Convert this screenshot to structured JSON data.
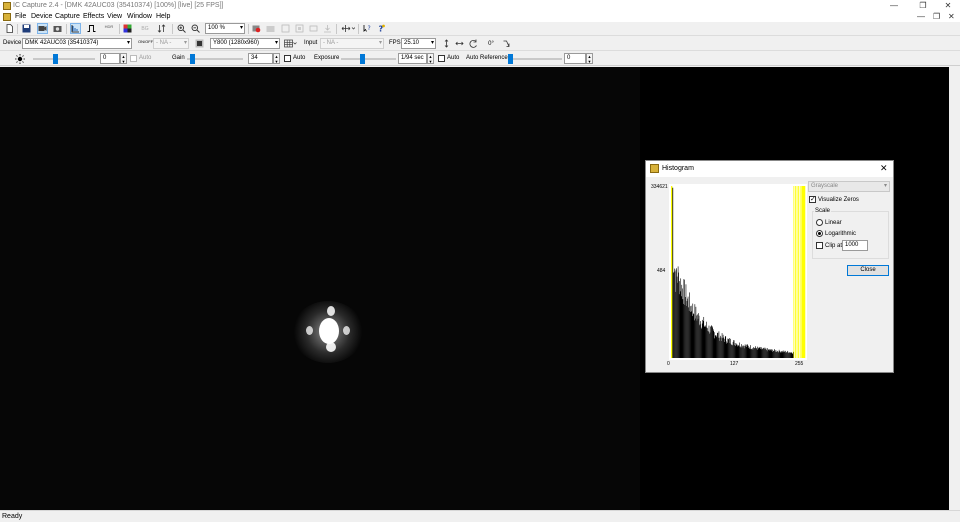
{
  "window": {
    "title": "IC Capture 2.4 - [DMK 42AUC03 (35410374) [100%]  [live]  [25 FPS]]",
    "controls": [
      "—",
      "❐",
      "✕"
    ]
  },
  "menu": [
    "File",
    "Device",
    "Capture",
    "Effects",
    "View",
    "Window",
    "Help"
  ],
  "mdi_controls": [
    "—",
    "❐",
    "✕"
  ],
  "toolbar": {
    "zoom_value": "100 %",
    "btn_hdr": "HDR",
    "btn_bg": "BG",
    "btn_onoff": "ON/OFF",
    "btn_angle": "0°"
  },
  "device_bar": {
    "device_label": "Device",
    "device_value": "DMK 42AUC03 (35410374)",
    "na_combo_1": "- NA -",
    "format_value": "Y800 (1280x960)",
    "input_label": "Input",
    "input_value": "- NA -",
    "fps_label": "FPS",
    "fps_value": "25.10"
  },
  "properties_bar": {
    "brightness_value": "0",
    "brightness_level": 0.35,
    "brightness_auto_label": "Auto",
    "gain_label": "Gain",
    "gain_value": "34",
    "gain_level": 0.06,
    "gain_auto_label": "Auto",
    "exposure_label": "Exposure",
    "exposure_value": "1/94 sec",
    "exposure_level": 0.38,
    "exposure_auto_label": "Auto",
    "auto_reference_label": "Auto Reference",
    "auto_reference_value": "0",
    "auto_reference_level": 0.0
  },
  "histogram": {
    "title": "Histogram",
    "y_max_label": "334621",
    "y_mid_label": "484",
    "x_labels": [
      "0",
      "127",
      "255"
    ],
    "mode_value": "Grayscale",
    "visualize_zeros_label": "Visualize Zeros",
    "visualize_zeros_checked": true,
    "scale_group_label": "Scale",
    "linear_label": "Linear",
    "logarithmic_label": "Logarithmic",
    "scale_selected": "Logarithmic",
    "clip_label": "Clip at",
    "clip_checked": false,
    "clip_value": "1000",
    "close_label": "Close",
    "accent_colors": {
      "bars": "#000000",
      "zeros": "#ffff00"
    }
  },
  "status": {
    "text": "Ready"
  }
}
